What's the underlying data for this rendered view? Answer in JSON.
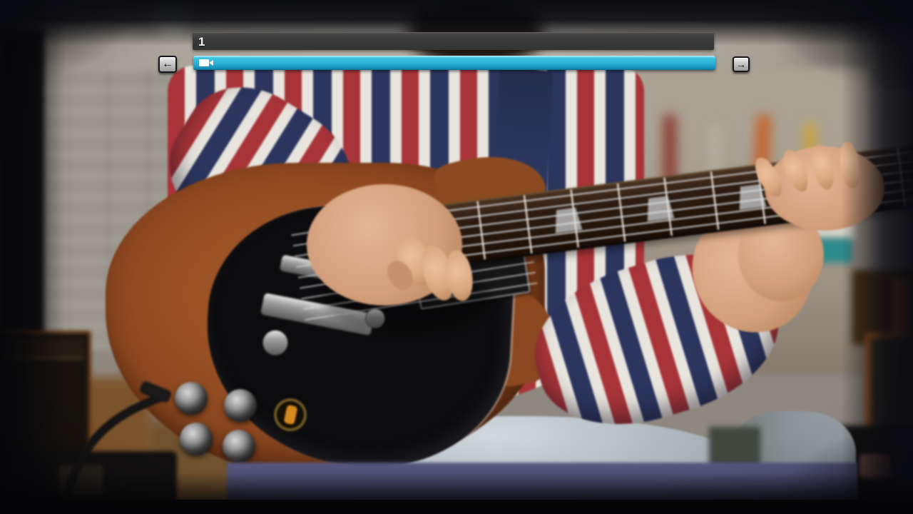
{
  "overlay": {
    "section_label": "1",
    "prev_label": "←",
    "next_label": "→",
    "progress_percent": 100
  },
  "icons": {
    "playhead": "video-camera-icon",
    "prev": "arrow-left-icon",
    "next": "arrow-right-icon"
  },
  "colors": {
    "progress_cyan": "#29b0d4",
    "label_bar_gray": "#3a3a3a",
    "nav_button_silver": "#c6c6c6",
    "stage_band_purple": "#4f4f72",
    "guitar_mahogany": "#8c4720",
    "pickguard_black": "#0c0c0e",
    "shirt_red": "#a83438",
    "shirt_navy": "#2b355e",
    "jeans_gray": "#a8b0b6"
  },
  "scene_alt": "Guitarist in a red, white and navy plaid shirt with a dark tie playing a mahogany SG-style electric guitar, in a blurred guitar room with hanging guitars and amplifier stacks"
}
